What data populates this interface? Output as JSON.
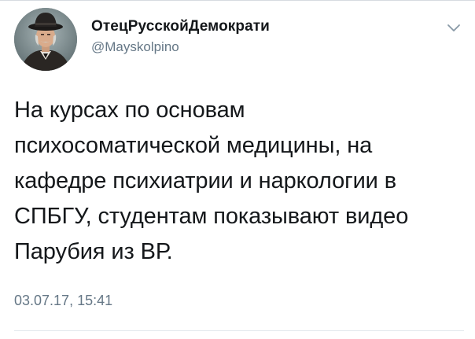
{
  "tweet": {
    "author": {
      "display_name": "ОтецРусскойДемократи",
      "handle": "@Mayskolpino",
      "avatar_icon": "profile-photo"
    },
    "menu_icon": "chevron-down-icon",
    "text_lines": [
      "На курсах по основам",
      "психосоматической медицины, на",
      "кафедре психиатрии и наркологии в",
      "СПБГУ, студентам показывают видео",
      "Парубия из ВР."
    ],
    "timestamp": "03.07.17, 15:41"
  },
  "colors": {
    "text": "#14171a",
    "secondary": "#657786",
    "divider": "#e1e8ed"
  }
}
